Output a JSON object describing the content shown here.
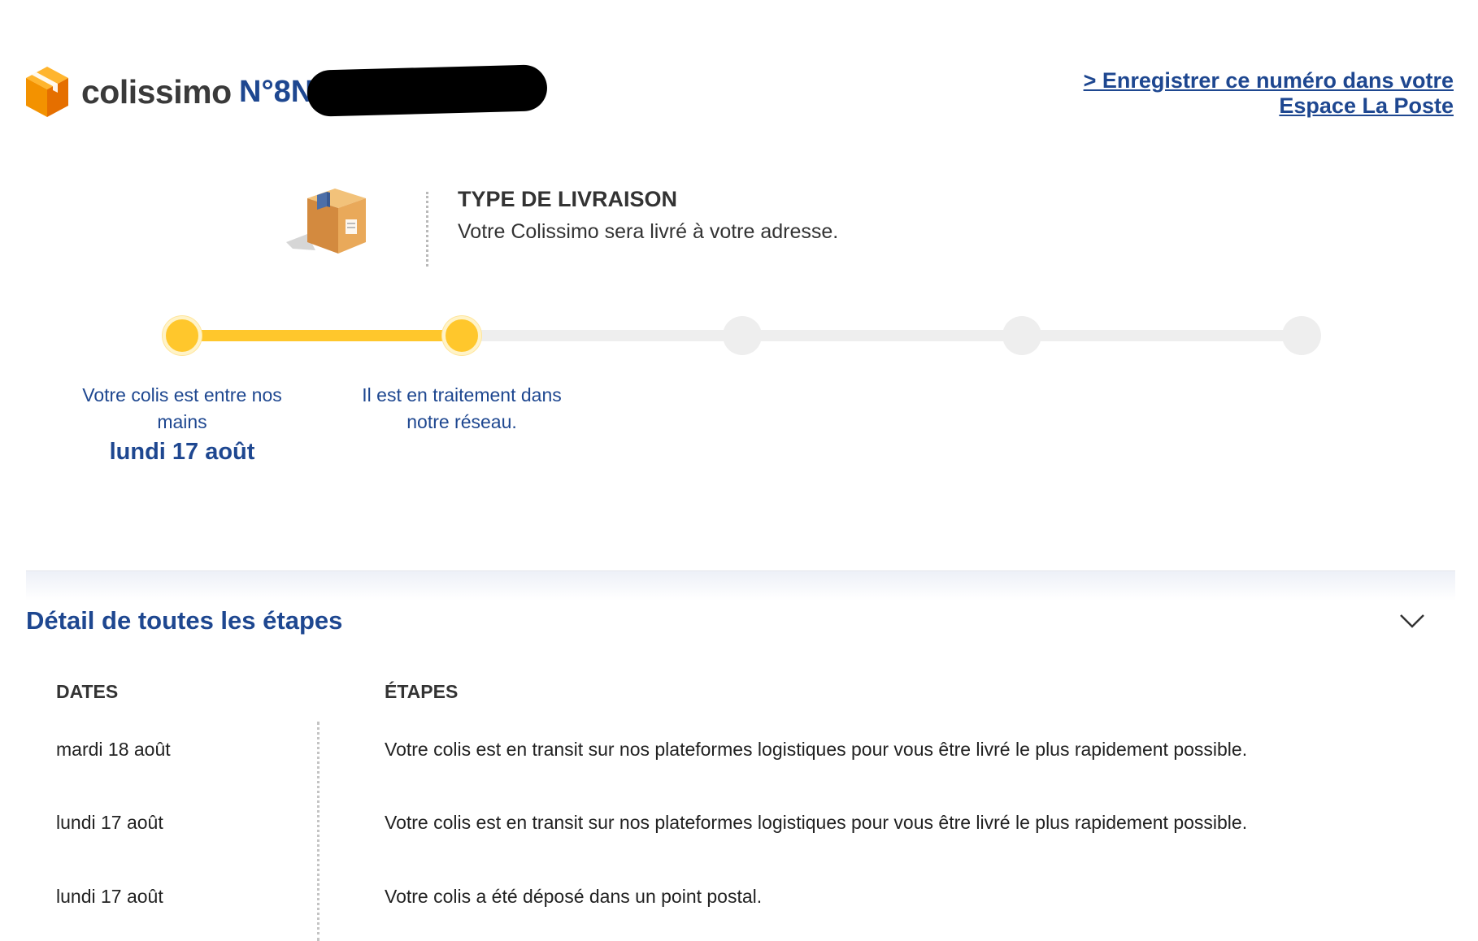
{
  "header": {
    "logo_text": "colissimo",
    "tracking_prefix": "N°8N",
    "register_link": "> Enregistrer ce numéro dans votre Espace La Poste"
  },
  "delivery_type": {
    "title": "TYPE DE LIVRAISON",
    "description": "Votre Colissimo sera livré à votre adresse."
  },
  "progress": {
    "completed_steps": 2,
    "total_steps": 5,
    "steps": [
      {
        "label": "Votre colis est entre nos mains",
        "date": "lundi 17 août"
      },
      {
        "label": "Il est en traitement dans notre réseau.",
        "date": ""
      }
    ]
  },
  "details": {
    "title": "Détail de toutes les étapes",
    "col_dates": "DATES",
    "col_steps": "ÉTAPES",
    "rows": [
      {
        "date": "mardi 18 août",
        "step": "Votre colis est en transit sur nos plateformes logistiques pour vous être livré le plus rapidement possible."
      },
      {
        "date": "lundi 17 août",
        "step": "Votre colis est en transit sur nos plateformes logistiques pour vous être livré le plus rapidement possible."
      },
      {
        "date": "lundi 17 août",
        "step": "Votre colis a été déposé dans un point postal."
      }
    ]
  },
  "colors": {
    "brand_blue": "#1e4790",
    "progress_yellow": "#ffc72c",
    "logo_orange": "#f39200",
    "inactive_grey": "#eeeeee"
  }
}
